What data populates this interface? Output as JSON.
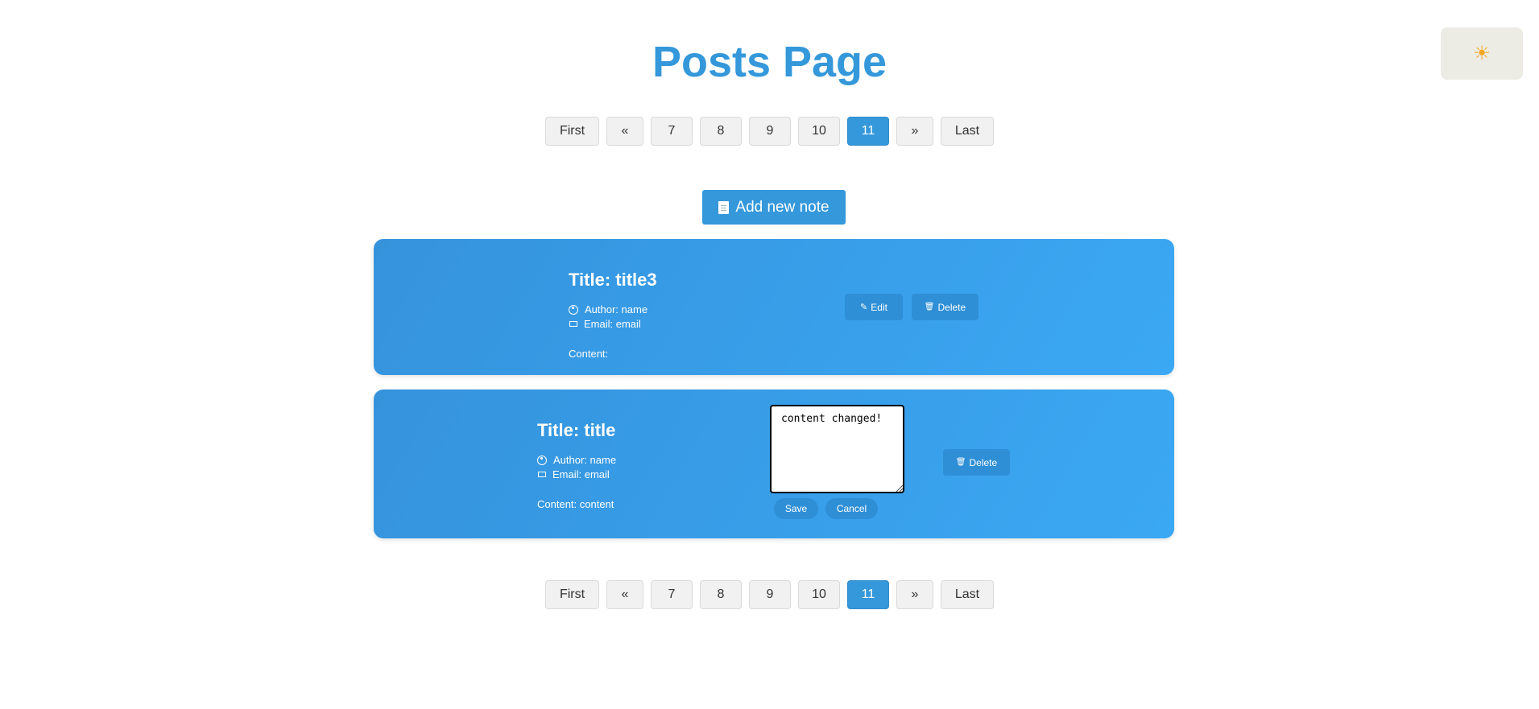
{
  "theme_toggle": {
    "icon": "☀"
  },
  "page_title": "Posts Page",
  "pagination": {
    "first": "First",
    "prev": "«",
    "pages": [
      "7",
      "8",
      "9",
      "10",
      "11"
    ],
    "active_page": "11",
    "next": "»",
    "last": "Last"
  },
  "add_note": {
    "icon": "document-icon",
    "label": "Add new note"
  },
  "posts": [
    {
      "title": "Title: title3",
      "author": "Author: name",
      "email": "Email: email",
      "content": "Content:",
      "edit_label": "Edit",
      "delete_label": "Delete"
    },
    {
      "title": "Title: title",
      "author": "Author: name",
      "email": "Email: email",
      "content": "Content: content",
      "editor_value": "content changed!",
      "save_label": "Save",
      "cancel_label": "Cancel",
      "delete_label": "Delete"
    }
  ],
  "colors": {
    "accent": "#3498db",
    "card_gradient_start": "#3593dc",
    "card_gradient_end": "#3ba8f4",
    "theme_toggle_bg": "#ecece4"
  }
}
